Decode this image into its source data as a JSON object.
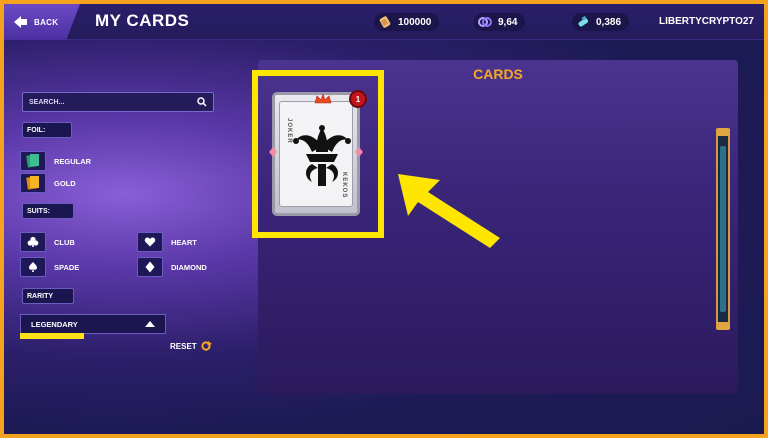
{
  "header": {
    "back_label": "BACK",
    "title": "MY CARDS",
    "stats": [
      {
        "icon": "scroll-icon",
        "value": "100000"
      },
      {
        "icon": "cards-icon",
        "value": "9,64"
      },
      {
        "icon": "potion-icon",
        "value": "0,386"
      }
    ],
    "username": "LIBERTYCRYPTO27"
  },
  "filters": {
    "search_placeholder": "SEARCH...",
    "foil_label": "FOIL:",
    "foil_options": [
      "REGULAR",
      "GOLD"
    ],
    "suits_label": "SUITS:",
    "suits": [
      "CLUB",
      "SPADE",
      "HEART",
      "DIAMOND"
    ],
    "rarity_label": "RARITY",
    "rarity_selected": "LEGENDARY",
    "reset_label": "RESET"
  },
  "cards_panel": {
    "title": "CARDS",
    "card": {
      "name_left": "JOKER",
      "name_right": "KEKOS",
      "count": "1"
    }
  },
  "colors": {
    "accent": "#f6a81f",
    "highlight": "#ffe600",
    "badge": "#c4141b"
  }
}
